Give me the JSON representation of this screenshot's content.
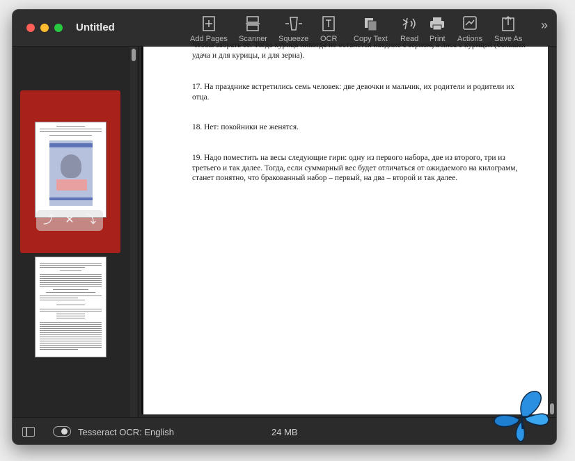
{
  "window": {
    "title": "Untitled"
  },
  "toolbar": {
    "items": [
      {
        "label": "Add Pages",
        "icon": "add-pages-icon"
      },
      {
        "label": "Scanner",
        "icon": "scanner-icon"
      },
      {
        "label": "Squeeze",
        "icon": "squeeze-icon"
      },
      {
        "label": "OCR",
        "icon": "ocr-icon"
      },
      {
        "label": "Copy Text",
        "icon": "copy-text-icon"
      },
      {
        "label": "Read",
        "icon": "read-icon"
      },
      {
        "label": "Print",
        "icon": "print-icon"
      },
      {
        "label": "Actions",
        "icon": "actions-icon"
      },
      {
        "label": "Save As",
        "icon": "save-as-icon"
      }
    ],
    "more": "»"
  },
  "document": {
    "paragraphs": [
      "Чтобы забрать ее. Тогда курица никогда не останется наедине с зерном, а лиса с курицей (большая удача и для курицы, и для зерна).",
      "17. На празднике встретились семь человек: две девочки и мальчик, их родители и родители их отца.",
      "18. Нет: покойники не женятся.",
      "19. Надо поместить на весы следующие гири: одну из первого набора, две из второго, три из третьего и так далее. Тогда, если суммарный вес будет отличаться от ожидаемого на килограмм, станет понятно, что бракованный набор – первый, на два – второй и так далее."
    ]
  },
  "status": {
    "ocr_label": "Tesseract OCR: English",
    "size": "24 MB"
  },
  "colors": {
    "selection": "#a8211a",
    "window_bg": "#262626",
    "traffic_close": "#ff5f57",
    "traffic_min": "#febc2e",
    "traffic_max": "#28c840"
  }
}
